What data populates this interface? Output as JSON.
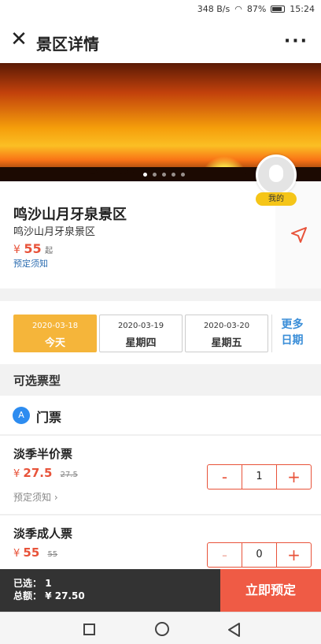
{
  "status_bar": {
    "signal": "348 B/s",
    "battery": "87%",
    "time": "15:24"
  },
  "app_bar": {
    "close_icon": "close-icon",
    "title": "景区详情",
    "more": "···"
  },
  "banner": {
    "image": "desert-sunset-camel-caravan"
  },
  "scenic": {
    "name": "鸣沙山月牙泉景区",
    "subtitle": "鸣沙山月牙泉景区",
    "currency": "¥",
    "price": "55",
    "price_suffix": "起",
    "notice": "预定须知"
  },
  "avatar": {
    "tag": "我的"
  },
  "dates": [
    {
      "date": "2020-03-18",
      "weekday": "今天"
    },
    {
      "date": "2020-03-19",
      "weekday": "星期四"
    },
    {
      "date": "2020-03-20",
      "weekday": "星期五"
    }
  ],
  "more_dates": {
    "line1": "更多",
    "line2": "日期"
  },
  "section_title": "可选票型",
  "category": {
    "badge": "A",
    "label": "门票"
  },
  "tickets": [
    {
      "name": "淡季半价票",
      "currency": "¥",
      "price": "27.5",
      "original": "27.5",
      "notice": "预定须知 ›",
      "qty": "1"
    },
    {
      "name": "淡季成人票",
      "currency": "¥",
      "price": "55",
      "original": "55",
      "qty": "0"
    }
  ],
  "stepper": {
    "minus": "-",
    "plus": "+"
  },
  "summary": {
    "selected_label": "已选：",
    "selected_value": "1",
    "total_label": "总额：",
    "total_value": "¥ 27.50"
  },
  "book_button": "立即预定",
  "colors": {
    "accent": "#e8533a",
    "date_active": "#f5b53a",
    "link": "#3a8ed8",
    "bar_dark": "#333333"
  }
}
